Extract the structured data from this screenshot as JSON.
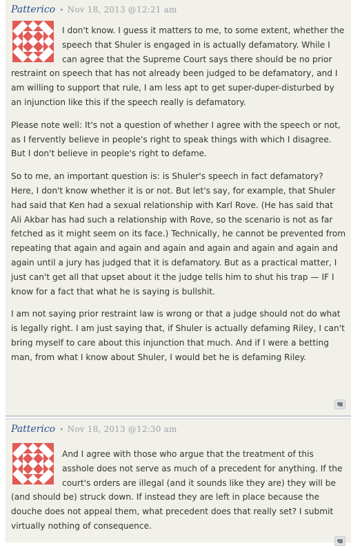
{
  "comments": [
    {
      "author": "Patterico",
      "separator": "•",
      "timestamp": "Nov 18, 2013 @12:21 am",
      "avatar_colors": [
        "#e05a57",
        "#ffffff"
      ],
      "paragraphs": [
        "I don't know. I guess it matters to me, to some extent, whether the speech that Shuler is engaged in is actually defamatory. While I can agree that the Supreme Court says there should be no prior restraint on speech that has not already been judged to be defamatory, and I am willing to support that rule, I am less apt to get super-duper-disturbed by an injunction like this if the speech really is defamatory.",
        "Please note well: It's not a question of whether I agree with the speech or not, as I fervently believe in people's right to speak things with which I disagree. But I don't believe in people's right to defame.",
        "So to me, an important question is: is Shuler's speech in fact defamatory? Here, I don't know whether it is or not. But let's say, for example, that Shuler had said that Ken had a sexual relationship with Karl Rove. (He has said that Ali Akbar has had such a relationship with Rove, so the scenario is not as far fetched as it might seem on its face.) Technically, he cannot be prevented from repeating that again and again and again and again and again and again and again until a jury has judged that it is defamatory. But as a practical matter, I just can't get all that upset about it the judge tells him to shut his trap — IF I know for a fact that what he is saying is bullshit.",
        "I am not saying prior restraint law is wrong or that a judge should not do what is legally right. I am just saying that, if Shuler is actually defaming Riley, I can't bring myself to care about this injunction that much. And if I were a betting man, from what I know about Shuler, I would bet he is defaming Riley."
      ]
    },
    {
      "author": "Patterico",
      "separator": "•",
      "timestamp": "Nov 18, 2013 @12:30 am",
      "avatar_colors": [
        "#e05a57",
        "#ffffff"
      ],
      "paragraphs": [
        "And I agree with those who argue that the treatment of this asshole does not serve as much of a precedent for anything. If the court's orders are illegal (and it sounds like they are) they will be (and should be) struck down. If instead they are left in place because the douche does not appeal them, what precedent does that really set? I submit virtually nothing of consequence."
      ]
    }
  ]
}
